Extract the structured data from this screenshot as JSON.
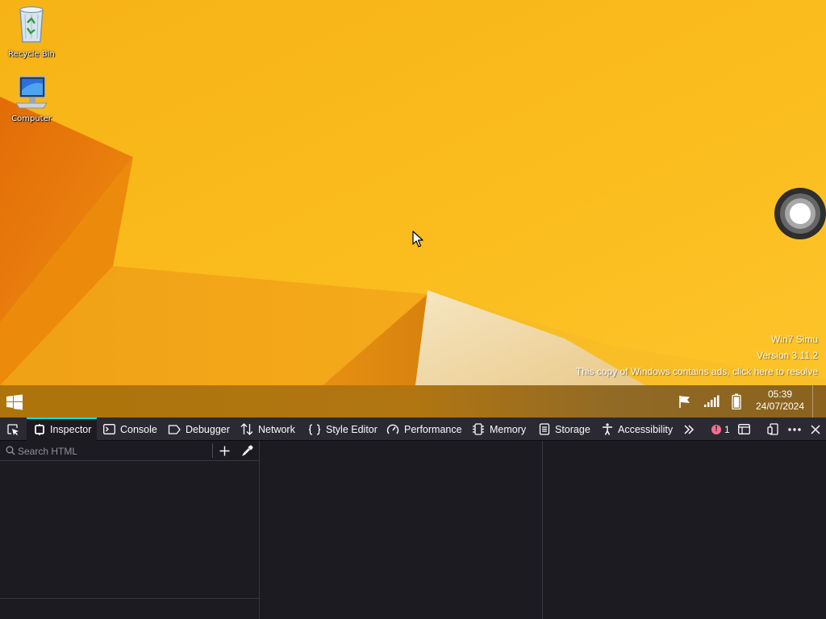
{
  "desktop": {
    "icons": [
      {
        "label": "Recycle Bin",
        "icon": "recycle-bin-icon"
      },
      {
        "label": "Computer",
        "icon": "computer-icon"
      }
    ],
    "watermark": {
      "line1": "Win7 Simu",
      "line2": "Version 3.11.2",
      "line3": "This copy of Windows contains ads, click here to resolve"
    }
  },
  "taskbar": {
    "start_icon": "windows-logo-icon",
    "tray_icons": [
      "action-center-flag-icon",
      "signal-strength-icon",
      "battery-icon"
    ],
    "clock": {
      "time": "05:39",
      "date": "24/07/2024"
    }
  },
  "devtools": {
    "tabs": [
      {
        "label": "Inspector",
        "icon": "inspector-icon",
        "active": true
      },
      {
        "label": "Console",
        "icon": "console-icon"
      },
      {
        "label": "Debugger",
        "icon": "debugger-icon"
      },
      {
        "label": "Network",
        "icon": "network-icon"
      },
      {
        "label": "Style Editor",
        "icon": "style-editor-icon"
      },
      {
        "label": "Performance",
        "icon": "performance-icon"
      },
      {
        "label": "Memory",
        "icon": "memory-icon"
      },
      {
        "label": "Storage",
        "icon": "storage-icon"
      },
      {
        "label": "Accessibility",
        "icon": "accessibility-icon"
      }
    ],
    "error_count": "1",
    "search": {
      "placeholder": "Search HTML"
    }
  },
  "colors": {
    "wallpaper_yellow": "#f8b818",
    "wallpaper_orange": "#e8760a",
    "devtools_bg": "#1c1b22",
    "devtools_toolbar": "#2b2a33",
    "active_tab_accent": "#00ddff",
    "error_badge": "#ff6b8d"
  }
}
